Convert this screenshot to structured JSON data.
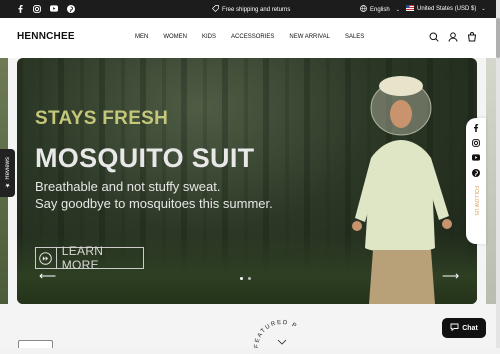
{
  "topbar": {
    "socials": [
      "facebook-icon",
      "instagram-icon",
      "youtube-icon",
      "pinterest-icon"
    ],
    "shipping": "Free shipping and returns",
    "language": "English",
    "currency": "United States (USD $)"
  },
  "header": {
    "logo": "HENNCHEE",
    "nav": [
      "MEN",
      "WOMEN",
      "KIDS",
      "ACCESSORIES",
      "NEW ARRIVAL",
      "SALES"
    ],
    "icons": [
      "search-icon",
      "account-icon",
      "cart-icon"
    ]
  },
  "hero": {
    "eyebrow": "STAYS FRESH",
    "title": "MOSQUITO SUIT",
    "line1": "Breathable and not stuffy sweat.",
    "line2": "Say goodbye to mosquitoes this summer.",
    "cta": "LEARN MORE",
    "prev": "⟵",
    "next": "⟶",
    "slides": 2,
    "active_slide": 1
  },
  "reviews_tab": "★ Reviews",
  "side_social": {
    "icons": [
      "facebook-icon",
      "instagram-icon",
      "youtube-icon",
      "pinterest-icon"
    ],
    "label": "FOLLOW US"
  },
  "featured": "FEATURED P",
  "chat": {
    "label": "Chat"
  },
  "colors": {
    "eyebrow": "#c4c77a",
    "topbar": "#1c1c1c",
    "chat": "#111111"
  }
}
